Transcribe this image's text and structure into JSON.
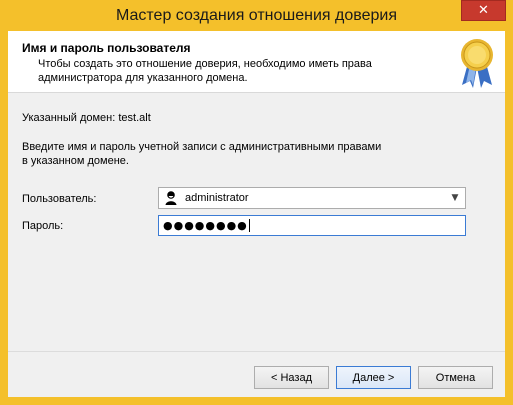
{
  "window": {
    "title": "Мастер создания отношения доверия",
    "close_label": "✕"
  },
  "header": {
    "title": "Имя и пароль пользователя",
    "subtitle": "Чтобы создать это отношение доверия, необходимо иметь права администратора для указанного домена."
  },
  "main": {
    "domain_line": "Указанный домен: test.alt",
    "instructions": "Введите имя и пароль учетной записи с административными правами в указанном домене.",
    "user_label": "Пользователь:",
    "user_value": "administrator",
    "password_label": "Пароль:",
    "password_mask": "●●●●●●●●"
  },
  "footer": {
    "back_label": "< Назад",
    "next_label": "Далее >",
    "cancel_label": "Отмена"
  },
  "colors": {
    "frame": "#f4c02b",
    "close_button": "#c7392d",
    "focus_border": "#3b7bd4"
  }
}
